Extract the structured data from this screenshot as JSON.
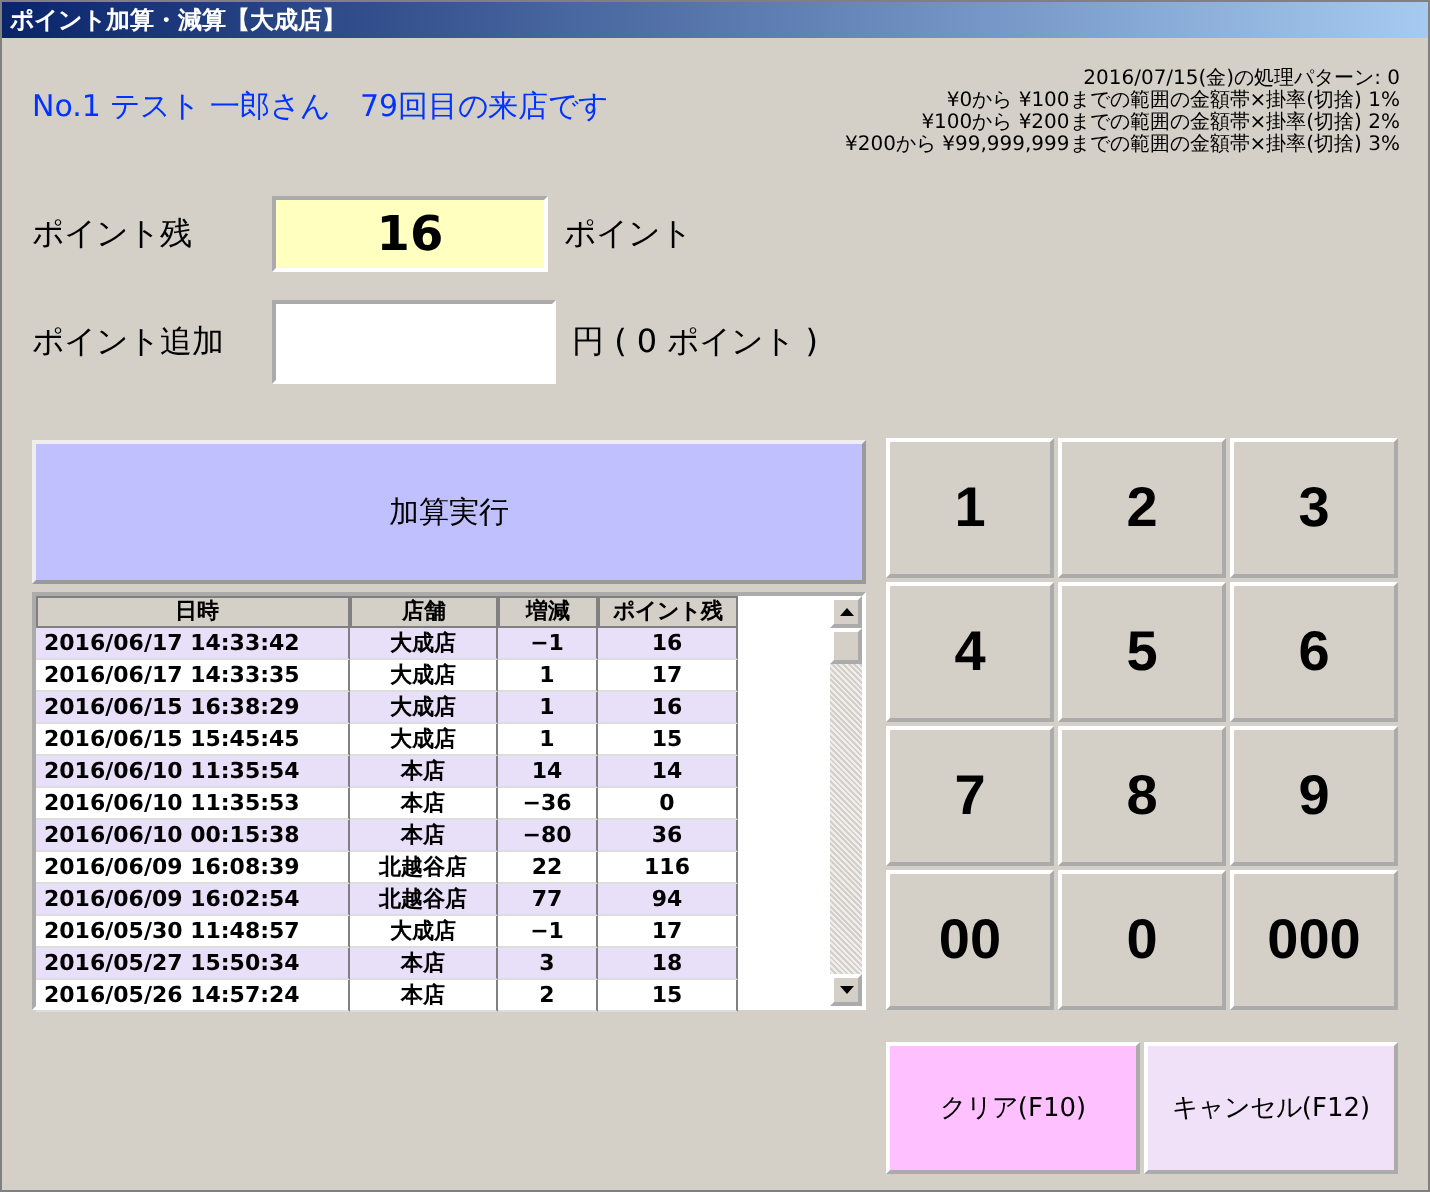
{
  "window": {
    "title": "ポイント加算・減算【大成店】"
  },
  "customer": "No.1 テスト 一郎さん　79回目の来店です",
  "rules": [
    "2016/07/15(金)の処理パターン: 0",
    "¥0から ¥100までの範囲の金額帯×掛率(切捨) 1%",
    "¥100から ¥200までの範囲の金額帯×掛率(切捨) 2%",
    "¥200から ¥99,999,999までの範囲の金額帯×掛率(切捨) 3%"
  ],
  "balance": {
    "label": "ポイント残",
    "value": "16",
    "unit": "ポイント"
  },
  "add": {
    "label": "ポイント追加",
    "unit": "円 ( 0 ポイント )"
  },
  "execute_button": "加算実行",
  "table": {
    "columns": [
      "日時",
      "店舗",
      "増減",
      "ポイント残"
    ],
    "rows": [
      [
        "2016/06/17 14:33:42",
        "大成店",
        "−1",
        "16"
      ],
      [
        "2016/06/17 14:33:35",
        "大成店",
        "1",
        "17"
      ],
      [
        "2016/06/15 16:38:29",
        "大成店",
        "1",
        "16"
      ],
      [
        "2016/06/15 15:45:45",
        "大成店",
        "1",
        "15"
      ],
      [
        "2016/06/10 11:35:54",
        "本店",
        "14",
        "14"
      ],
      [
        "2016/06/10 11:35:53",
        "本店",
        "−36",
        "0"
      ],
      [
        "2016/06/10 00:15:38",
        "本店",
        "−80",
        "36"
      ],
      [
        "2016/06/09 16:08:39",
        "北越谷店",
        "22",
        "116"
      ],
      [
        "2016/06/09 16:02:54",
        "北越谷店",
        "77",
        "94"
      ],
      [
        "2016/05/30 11:48:57",
        "大成店",
        "−1",
        "17"
      ],
      [
        "2016/05/27 15:50:34",
        "本店",
        "3",
        "18"
      ],
      [
        "2016/05/26 14:57:24",
        "本店",
        "2",
        "15"
      ]
    ]
  },
  "keypad": [
    "1",
    "2",
    "3",
    "4",
    "5",
    "6",
    "7",
    "8",
    "9",
    "00",
    "0",
    "000"
  ],
  "clear_button": "クリア(F10)",
  "cancel_button": "キャンセル(F12)"
}
